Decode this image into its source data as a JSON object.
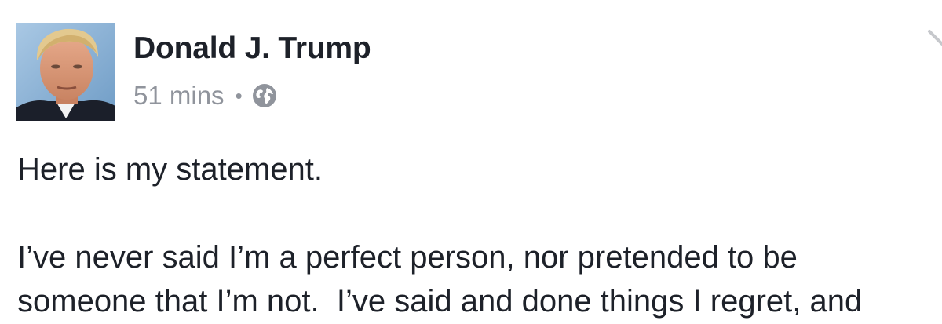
{
  "post": {
    "author": "Donald J. Trump",
    "timestamp": "51 mins",
    "separator": "•",
    "privacy_icon": "globe-icon",
    "menu_icon": "chevron-down-icon",
    "paragraphs": [
      "Here is my statement.",
      "I’ve never said I’m a perfect person, nor pretended to be\nsomeone that I’m not.  I’ve said and done things I regret, and"
    ]
  },
  "colors": {
    "text_primary": "#1d2129",
    "text_secondary": "#90949c",
    "background": "#ffffff"
  }
}
